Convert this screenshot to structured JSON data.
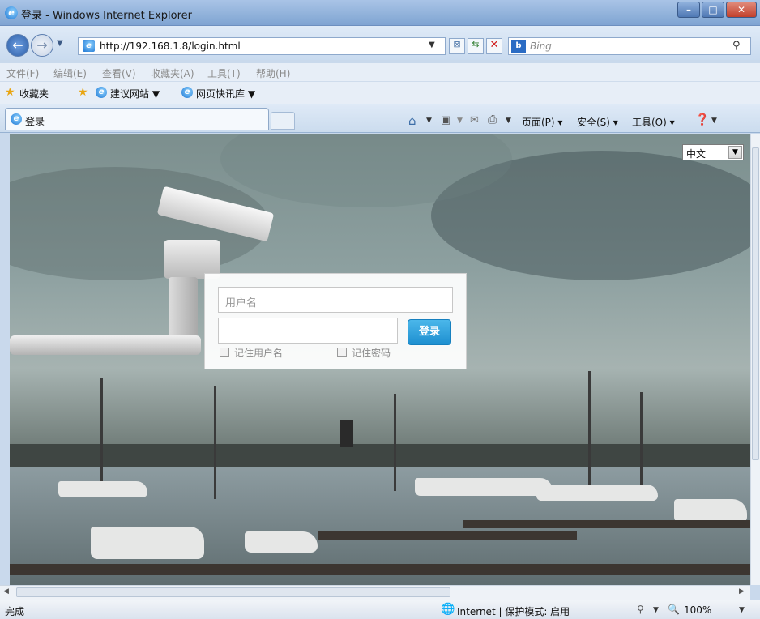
{
  "window": {
    "title": "登录 - Windows Internet Explorer"
  },
  "address": {
    "url": "http://192.168.1.8/login.html",
    "search_placeholder": "Bing"
  },
  "menu": [
    "文件(F)",
    "编辑(E)",
    "查看(V)",
    "收藏夹(A)",
    "工具(T)",
    "帮助(H)"
  ],
  "favorites": {
    "favorites_label": "收藏夹",
    "suggested_sites": "建议网站 ▼",
    "web_slice": "网页快讯库 ▼"
  },
  "tab": {
    "title": "登录"
  },
  "commandbar": {
    "page": "页面(P) ▾",
    "safety": "安全(S) ▾",
    "tools": "工具(O) ▾"
  },
  "login": {
    "language": "中文",
    "username_placeholder": "用户名",
    "password_value": "",
    "login_button": "登录",
    "remember_username": "记住用户名",
    "remember_password": "记住密码"
  },
  "status": {
    "text": "完成",
    "zone": "Internet | 保护模式: 启用",
    "zoom": "100%"
  },
  "colors": {
    "accent": "#1e8fd0",
    "titlebar": "#7fa4d2"
  }
}
